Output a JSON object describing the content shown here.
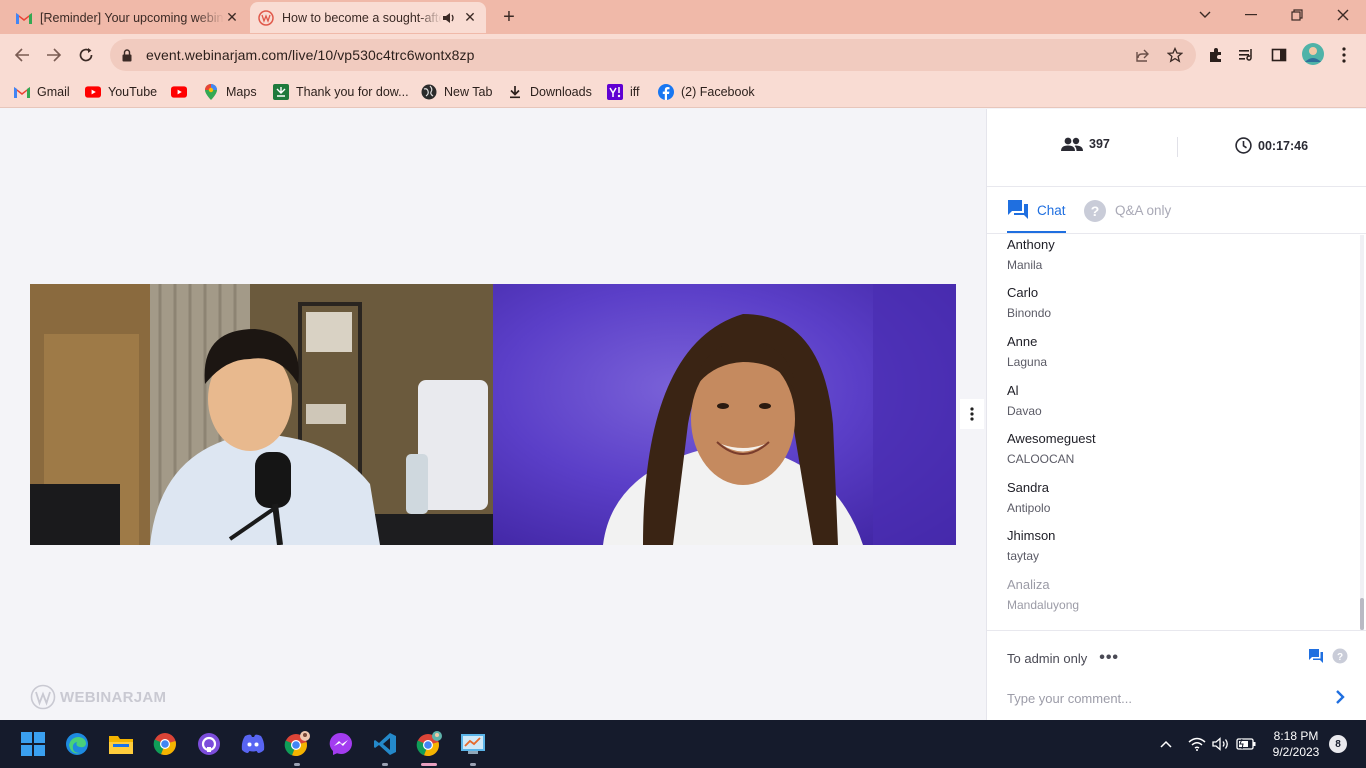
{
  "browser": {
    "tabs": [
      {
        "title": "[Reminder] Your upcoming webinar",
        "favicon": "gmail-icon",
        "active": false
      },
      {
        "title": "How to become a sought-after",
        "favicon": "webinarjam-icon",
        "active": true
      }
    ],
    "url": "event.webinarjam.com/live/10/vp530c4trc6wontx8zp",
    "bookmarks": [
      {
        "label": "Gmail",
        "icon": "gmail-icon"
      },
      {
        "label": "YouTube",
        "icon": "youtube-icon"
      },
      {
        "label": "",
        "icon": "youtube-icon"
      },
      {
        "label": "Maps",
        "icon": "maps-icon"
      },
      {
        "label": "Thank you for dow...",
        "icon": "download-page-icon"
      },
      {
        "label": "New Tab",
        "icon": "globe-icon"
      },
      {
        "label": "Downloads",
        "icon": "download-icon"
      },
      {
        "label": "iff",
        "icon": "yahoo-icon"
      },
      {
        "label": "(2) Facebook",
        "icon": "facebook-icon"
      }
    ]
  },
  "webinar": {
    "brand": "WEBINARJAM",
    "attendees": "397",
    "elapsed": "00:17:46",
    "tabs": {
      "chat": "Chat",
      "qa": "Q&A only"
    },
    "messages": [
      {
        "name": "Anthony",
        "location": "Manila"
      },
      {
        "name": "Carlo",
        "location": "Binondo"
      },
      {
        "name": "Anne",
        "location": "Laguna"
      },
      {
        "name": "Al",
        "location": "Davao"
      },
      {
        "name": "Awesomeguest",
        "location": "CALOOCAN"
      },
      {
        "name": "Sandra",
        "location": "Antipolo"
      },
      {
        "name": "Jhimson",
        "location": "taytay"
      },
      {
        "name": "Analiza",
        "location": "Mandaluyong"
      }
    ],
    "to_admin": "To admin only",
    "comment_placeholder": "Type your comment..."
  },
  "taskbar": {
    "time": "8:18 PM",
    "date": "9/2/2023",
    "notifications": "8"
  },
  "colors": {
    "tabstrip": "#f0b9a9",
    "toolbar": "#f9dcd3",
    "accent": "#1f6fe0",
    "taskbar": "#151b2c"
  }
}
